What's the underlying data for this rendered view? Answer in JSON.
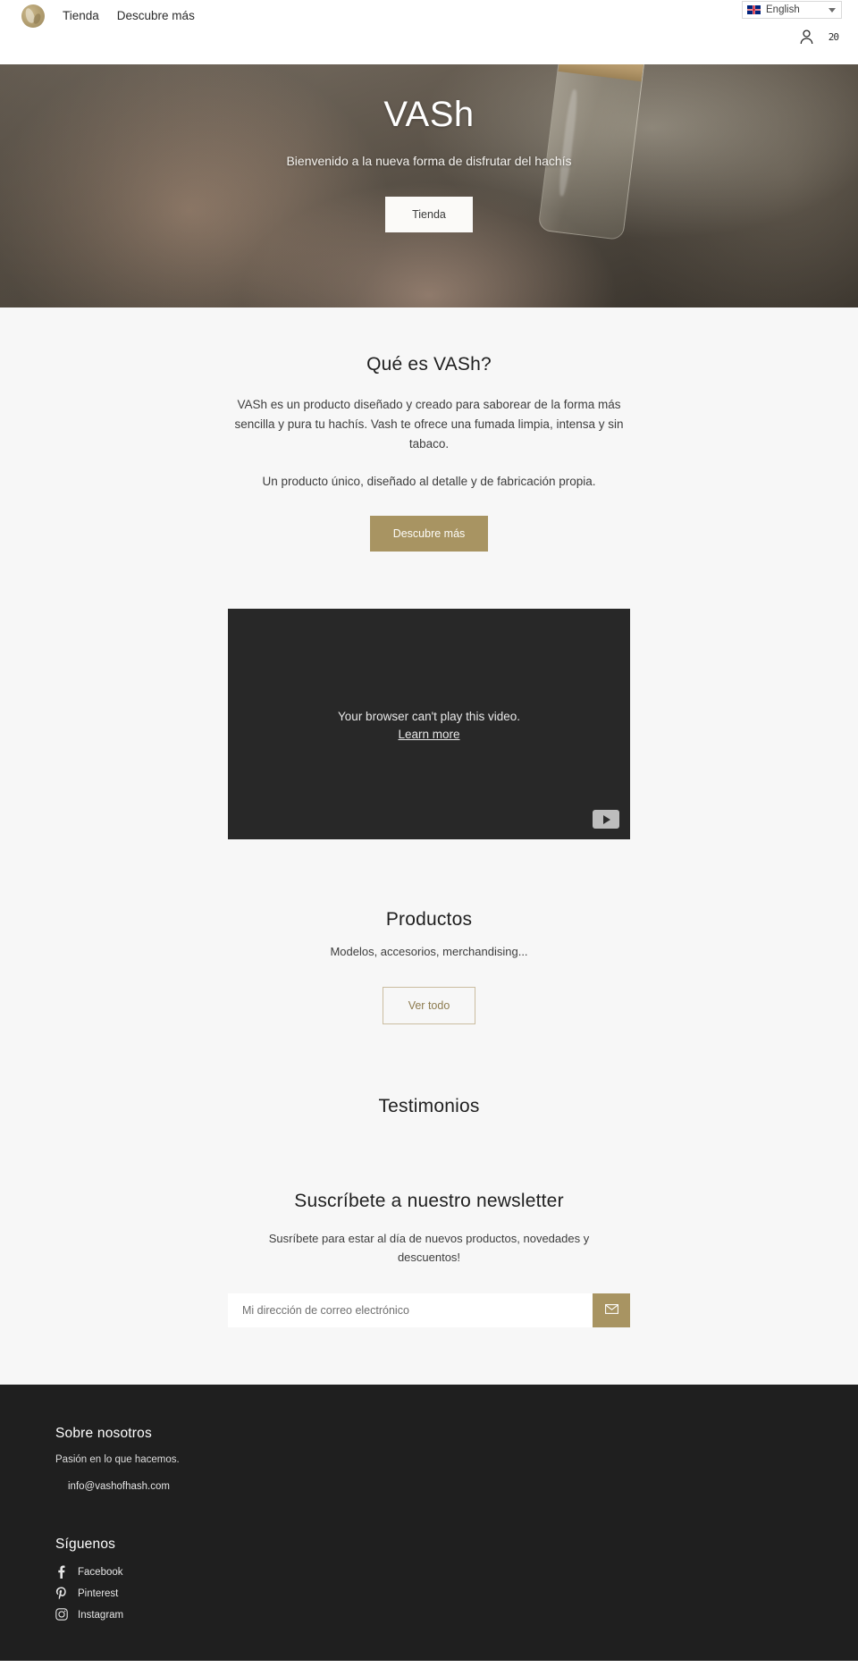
{
  "header": {
    "logo_alt": "VASh logo",
    "nav": [
      {
        "label": "Tienda"
      },
      {
        "label": "Descubre más"
      }
    ],
    "language": {
      "selected": "English",
      "flag": "uk-flag-icon",
      "chevron": "chevron-down-icon"
    },
    "account_icon": "user-icon",
    "cart_icon": "cart-icon",
    "cart_count": "20"
  },
  "hero": {
    "title": "VASh",
    "subtitle": "Bienvenido a la nueva forma de disfrutar del hachís",
    "cta": "Tienda"
  },
  "about": {
    "heading": "Qué es VASh?",
    "paragraph1": "VASh es un producto diseñado y creado para saborear de la forma más sencilla y pura tu hachís. Vash te ofrece una fumada limpia, intensa y sin tabaco.",
    "paragraph2": "Un producto único, diseñado al detalle y de fabricación propia.",
    "cta": "Descubre más"
  },
  "video": {
    "message": "Your browser can't play this video.",
    "link": "Learn more",
    "play_icon": "play-icon"
  },
  "products": {
    "heading": "Productos",
    "subtitle": "Modelos, accesorios, merchandising...",
    "cta": "Ver todo"
  },
  "testimonials": {
    "heading": "Testimonios"
  },
  "newsletter": {
    "heading": "Suscríbete a nuestro newsletter",
    "subtitle": "Susríbete para estar al día de nuevos productos, novedades y descuentos!",
    "input_placeholder": "Mi dirección de correo electrónico",
    "input_value": "",
    "submit_icon": "envelope-icon"
  },
  "footer": {
    "about": {
      "heading": "Sobre nosotros",
      "tagline": "Pasión en lo que hacemos.",
      "email": "info@vashofhash.com"
    },
    "social": {
      "heading": "Síguenos",
      "items": [
        {
          "label": "Facebook",
          "icon": "facebook-icon",
          "glyph": "f"
        },
        {
          "label": "Pinterest",
          "icon": "pinterest-icon",
          "glyph": "P"
        },
        {
          "label": "Instagram",
          "icon": "instagram-icon",
          "glyph": "▣"
        }
      ]
    }
  },
  "colors": {
    "accent": "#a89462",
    "accent_border": "#cbbda0",
    "accent_text": "#8d7b4f",
    "light_bg": "#f7f7f7",
    "footer_bg": "#1f1f1f",
    "video_bg": "#282828"
  }
}
